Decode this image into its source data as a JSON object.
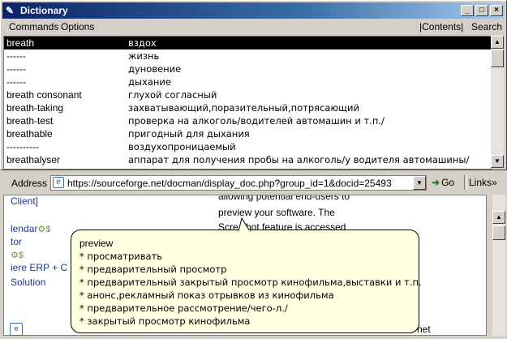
{
  "window": {
    "title": "Dictionary",
    "controls": {
      "minimize": "_",
      "maximize": "□",
      "close": "×"
    }
  },
  "menubar": {
    "commands": "Commands",
    "options": "Options",
    "contents": "|Contents|",
    "search": "Search"
  },
  "list": {
    "rows": [
      {
        "word": "breath",
        "translation": "вздох",
        "selected": true
      },
      {
        "word": "------",
        "translation": "жизнь"
      },
      {
        "word": "------",
        "translation": "дуновение"
      },
      {
        "word": "------",
        "translation": "дыхание"
      },
      {
        "word": "breath consonant",
        "translation": "глухой согласный"
      },
      {
        "word": "breath-taking",
        "translation": "захватывающий,поразительный,потрясающий"
      },
      {
        "word": "breath-test",
        "translation": "проверка на алкоголь/водителей автомашин и т.п./"
      },
      {
        "word": "breathable",
        "translation": "пригодный для дыхания"
      },
      {
        "word": "----------",
        "translation": "воздухопроницаемый"
      },
      {
        "word": "breathalyser",
        "translation": "аппарат для получения пробы на алкоголь/у водителя автомашины/"
      }
    ]
  },
  "browser": {
    "address_label": "Address",
    "url": "https://sourceforge.net/docman/display_doc.php?group_id=1&docid=25493",
    "go_label": "Go",
    "links_label": "Links",
    "chevron": "»",
    "left_lines": [
      "Client]",
      "lendar",
      "tor",
      "",
      "iere ERP + C",
      "Solution"
    ],
    "right_lines": [
      "allowing potential end-users to",
      "preview your software. The",
      "Scre    shot feature is accessed"
    ],
    "status_text": "net"
  },
  "tooltip": {
    "lines": [
      "preview",
      "* просматривать",
      "* предварительный просмотр",
      "* предварительный закрытый просмотр кинофильма,выставки и т.п.",
      "* анонс,рекламный показ отрывков из кинофильма",
      "* предварительное рассмотрение/чего-л./",
      "* закрытый просмотр кинофильма"
    ]
  }
}
